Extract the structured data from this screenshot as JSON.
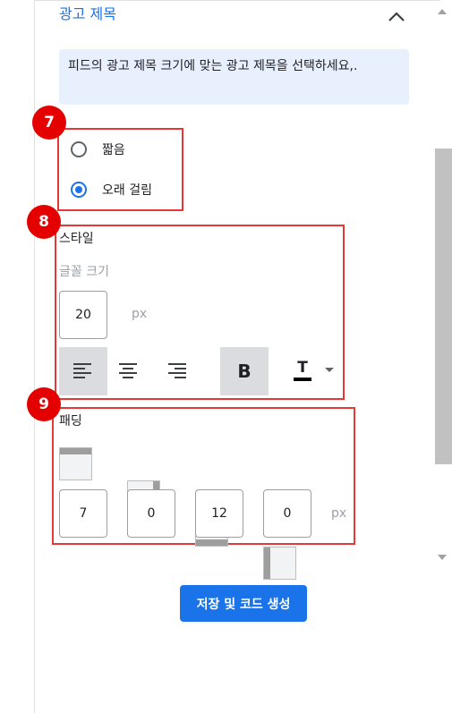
{
  "section": {
    "title": "광고 제목",
    "collapse_icon": "chevron-up-icon"
  },
  "info": {
    "text": "피드의 광고 제목 크기에 맞는 광고 제목을 선택하세요,."
  },
  "length_options": [
    {
      "label": "짧음",
      "selected": false
    },
    {
      "label": "오래 걸림",
      "selected": true
    }
  ],
  "style": {
    "heading": "스타일",
    "font_size_label": "글꼴 크기",
    "font_size_value": "20",
    "unit": "px",
    "toolbar": [
      {
        "icon": "align-left-icon",
        "active": true
      },
      {
        "icon": "align-center-icon",
        "active": false
      },
      {
        "icon": "align-right-icon",
        "active": false
      },
      {
        "icon": "bold-icon",
        "label": "B",
        "active": true
      },
      {
        "icon": "text-color-icon",
        "label": "T",
        "color": "#000000"
      }
    ]
  },
  "padding": {
    "heading": "패딩",
    "values": [
      "7",
      "0",
      "12",
      "0"
    ],
    "unit": "px",
    "icons": [
      "padding-top-icon",
      "padding-right-icon",
      "padding-bottom-icon",
      "padding-left-icon"
    ]
  },
  "annotations": [
    "7",
    "8",
    "9"
  ],
  "save_button": {
    "label": "저장 및 코드 생성"
  },
  "colors": {
    "accent": "#1a73e8",
    "highlight": "#e53935",
    "badge": "#e50000",
    "info_bg": "#e8f0fe"
  }
}
